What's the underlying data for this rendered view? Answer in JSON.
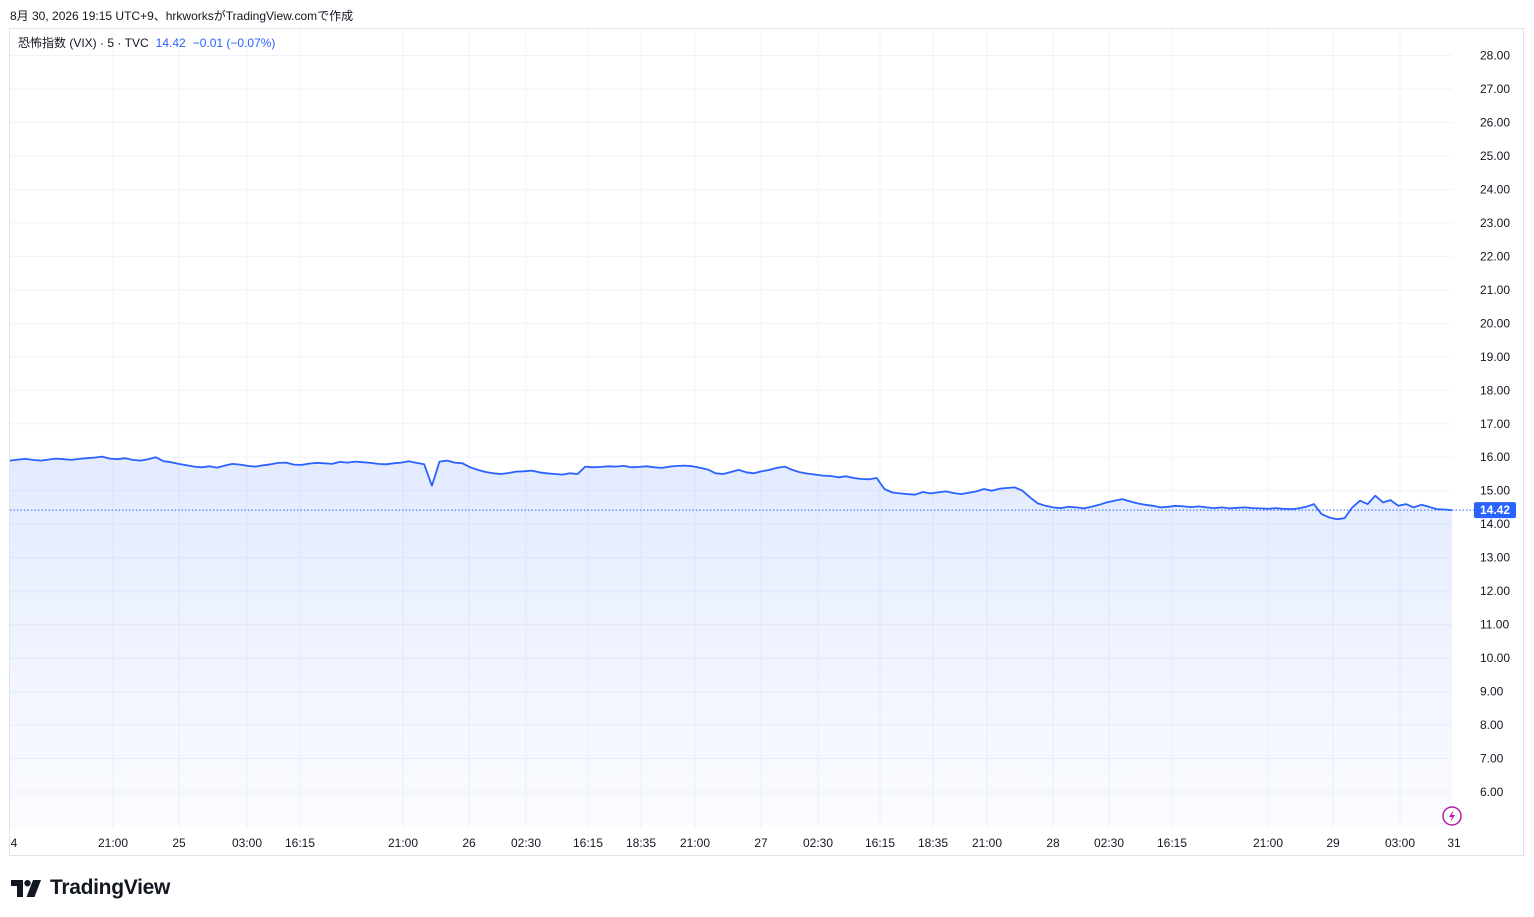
{
  "caption": "8月 30, 2026 19:15 UTC+9、hrkworksがTradingView.comで作成",
  "legend": {
    "symbol": "恐怖指数 (VIX) · 5 · TVC",
    "last": "14.42",
    "change": "−0.01 (−0.07%)"
  },
  "brand": {
    "name": "TradingView"
  },
  "colors": {
    "line": "#2962ff",
    "fill": "#2962ff",
    "label_bg": "#2962ff",
    "lightning": "#b81ab1"
  },
  "icons": {
    "lightning": "lightning-icon",
    "logo": "tradingview-logo-icon"
  },
  "chart_data": {
    "type": "area",
    "title": "恐怖指数 (VIX) · 5 · TVC",
    "ylim": [
      5,
      28.5
    ],
    "y_ticks": [
      "28.00",
      "27.00",
      "26.00",
      "25.00",
      "24.00",
      "23.00",
      "22.00",
      "21.00",
      "20.00",
      "19.00",
      "18.00",
      "17.00",
      "16.00",
      "15.00",
      "14.00",
      "13.00",
      "12.00",
      "11.00",
      "10.00",
      "9.00",
      "8.00",
      "7.00",
      "6.00"
    ],
    "x_ticks": [
      "4",
      "21:00",
      "25",
      "03:00",
      "16:15",
      "21:00",
      "26",
      "02:30",
      "16:15",
      "18:35",
      "21:00",
      "27",
      "02:30",
      "16:15",
      "18:35",
      "21:00",
      "28",
      "02:30",
      "16:15",
      "21:00",
      "29",
      "03:00",
      "31"
    ],
    "last_value_label": "14.42",
    "series": [
      {
        "values": [
          15.9,
          15.93,
          15.95,
          15.92,
          15.9,
          15.93,
          15.96,
          15.94,
          15.92,
          15.95,
          15.97,
          15.99,
          16.02,
          15.96,
          15.94,
          15.97,
          15.92,
          15.9,
          15.94,
          16.0,
          15.88,
          15.85,
          15.8,
          15.76,
          15.72,
          15.7,
          15.73,
          15.69,
          15.75,
          15.8,
          15.78,
          15.74,
          15.72,
          15.76,
          15.79,
          15.83,
          15.84,
          15.78,
          15.77,
          15.81,
          15.83,
          15.82,
          15.8,
          15.86,
          15.84,
          15.87,
          15.85,
          15.83,
          15.8,
          15.79,
          15.82,
          15.84,
          15.88,
          15.83,
          15.79,
          15.15,
          15.87,
          15.9,
          15.84,
          15.82,
          15.7,
          15.62,
          15.56,
          15.52,
          15.5,
          15.53,
          15.57,
          15.58,
          15.6,
          15.55,
          15.52,
          15.5,
          15.48,
          15.52,
          15.5,
          15.72,
          15.7,
          15.71,
          15.73,
          15.72,
          15.74,
          15.7,
          15.71,
          15.73,
          15.7,
          15.68,
          15.72,
          15.74,
          15.75,
          15.73,
          15.68,
          15.63,
          15.52,
          15.5,
          15.56,
          15.62,
          15.55,
          15.52,
          15.58,
          15.62,
          15.68,
          15.72,
          15.62,
          15.55,
          15.51,
          15.48,
          15.45,
          15.44,
          15.4,
          15.43,
          15.38,
          15.35,
          15.34,
          15.38,
          15.05,
          14.95,
          14.92,
          14.9,
          14.88,
          14.96,
          14.92,
          14.95,
          14.98,
          14.93,
          14.9,
          14.94,
          14.98,
          15.05,
          15.0,
          15.06,
          15.08,
          15.1,
          15.0,
          14.8,
          14.62,
          14.55,
          14.5,
          14.48,
          14.52,
          14.5,
          14.47,
          14.52,
          14.58,
          14.65,
          14.7,
          14.75,
          14.68,
          14.62,
          14.58,
          14.55,
          14.5,
          14.52,
          14.55,
          14.53,
          14.51,
          14.53,
          14.5,
          14.48,
          14.5,
          14.47,
          14.49,
          14.5,
          14.48,
          14.47,
          14.46,
          14.48,
          14.46,
          14.45,
          14.47,
          14.52,
          14.6,
          14.3,
          14.2,
          14.15,
          14.18,
          14.5,
          14.7,
          14.6,
          14.85,
          14.65,
          14.72,
          14.55,
          14.6,
          14.5,
          14.58,
          14.52,
          14.45,
          14.44,
          14.42
        ]
      }
    ]
  }
}
